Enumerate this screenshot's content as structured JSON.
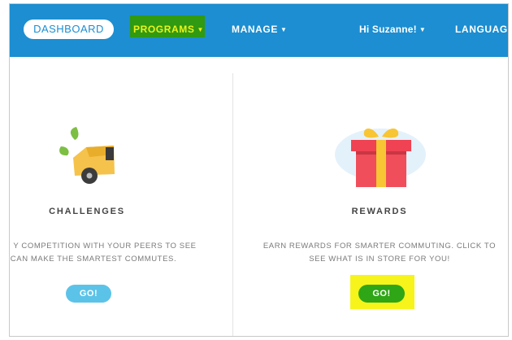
{
  "nav": {
    "dashboard": "DASHBOARD",
    "programs": "PROGRAMS",
    "manage": "MANAGE",
    "user_greeting": "Hi Suzanne!",
    "language": "LANGUAG",
    "caret": "▼"
  },
  "cards": [
    {
      "title": "CHALLENGES",
      "desc_line1": "Y COMPETITION WITH YOUR PEERS TO SEE",
      "desc_line2": "CAN MAKE THE SMARTEST COMMUTES.",
      "button": "GO!",
      "icon": "car-leaf-icon"
    },
    {
      "title": "REWARDS",
      "desc_line1": "EARN REWARDS FOR SMARTER COMMUTING. CLICK TO",
      "desc_line2": "SEE WHAT IS IN STORE FOR YOU!",
      "button": "GO!",
      "icon": "gift-icon"
    }
  ],
  "colors": {
    "topbar": "#1c8ed1",
    "programs_highlight": "#2f9a12",
    "go_highlight": "#f6f41a",
    "go_left": "#5cc3e8",
    "go_right": "#2ea615"
  }
}
